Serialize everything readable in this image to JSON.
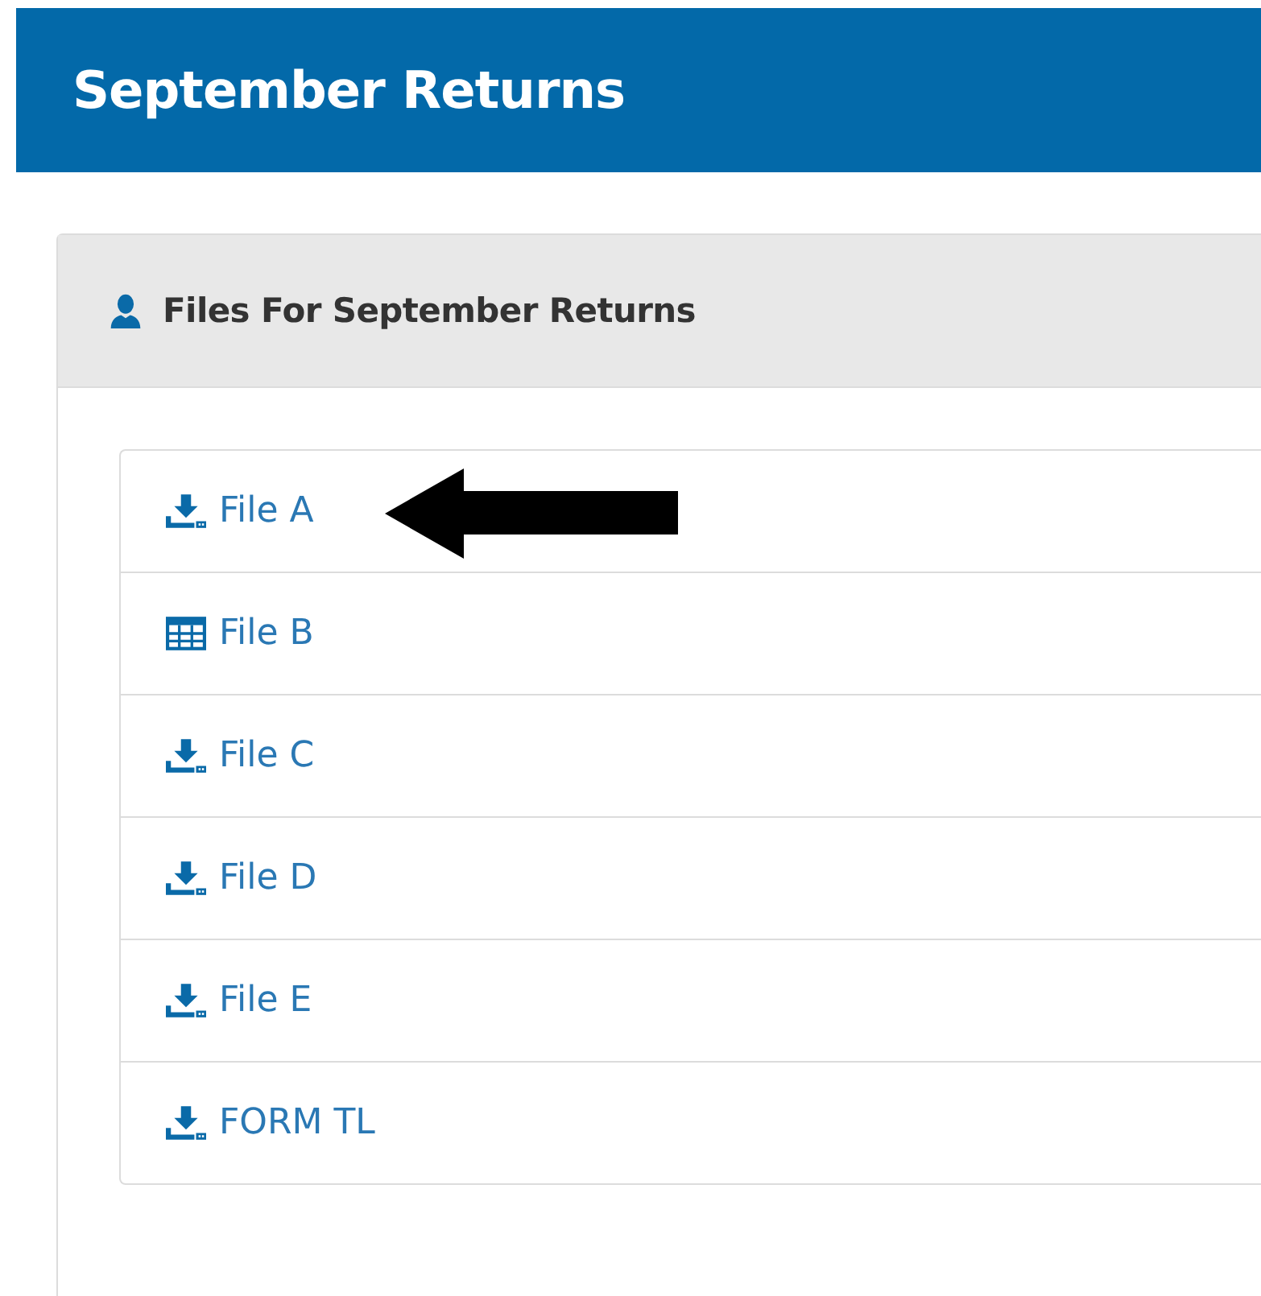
{
  "page": {
    "title": "September Returns"
  },
  "panel": {
    "title": "Files For September Returns"
  },
  "files": [
    {
      "kind": "download",
      "label": "File A",
      "annotated": true
    },
    {
      "kind": "table",
      "label": "File B",
      "annotated": false
    },
    {
      "kind": "download",
      "label": "File C",
      "annotated": false
    },
    {
      "kind": "download",
      "label": "File D",
      "annotated": false
    },
    {
      "kind": "download",
      "label": "File E",
      "annotated": false
    },
    {
      "kind": "download",
      "label": "FORM TL",
      "annotated": false
    }
  ]
}
